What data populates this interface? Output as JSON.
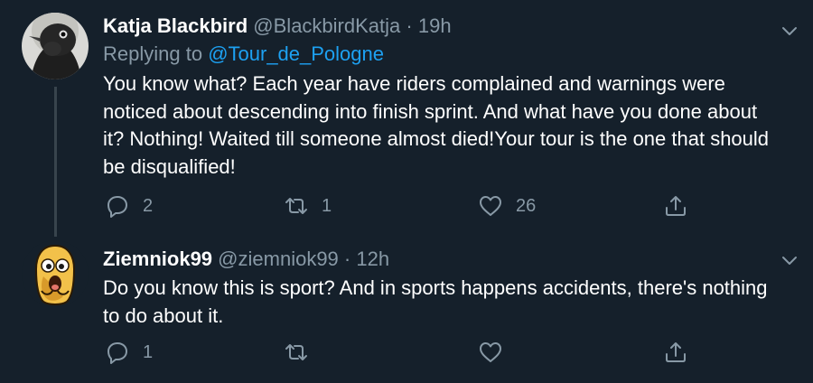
{
  "tweets": [
    {
      "display_name": "Katja Blackbird",
      "handle": "@BlackbirdKatja",
      "separator": "·",
      "time": "19h",
      "replying_prefix": "Replying to ",
      "replying_to": "@Tour_de_Pologne",
      "text": "You know what? Each year have riders complained and warnings were noticed about descending into finish sprint. And what have you done about it? Nothing! Waited till someone almost died!Your tour is the one that should be disqualified!",
      "replies": "2",
      "retweets": "1",
      "likes": "26",
      "avatar_icon": "bird-photo-avatar"
    },
    {
      "display_name": "Ziemniok99",
      "handle": "@ziemniok99",
      "separator": "·",
      "time": "12h",
      "text": "Do you know this is sport? And in sports happens accidents, there's nothing to do about it.",
      "replies": "1",
      "retweets": "",
      "likes": "",
      "avatar_icon": "potato-cartoon-avatar"
    }
  ],
  "icons": {
    "reply": "reply-icon",
    "retweet": "retweet-icon",
    "like": "heart-icon",
    "share": "share-icon",
    "menu": "chevron-down-icon"
  },
  "colors": {
    "background": "#15202b",
    "primary_text": "#ffffff",
    "secondary_text": "#8899a6",
    "accent": "#1da1f2",
    "thread_line": "#38444d"
  }
}
